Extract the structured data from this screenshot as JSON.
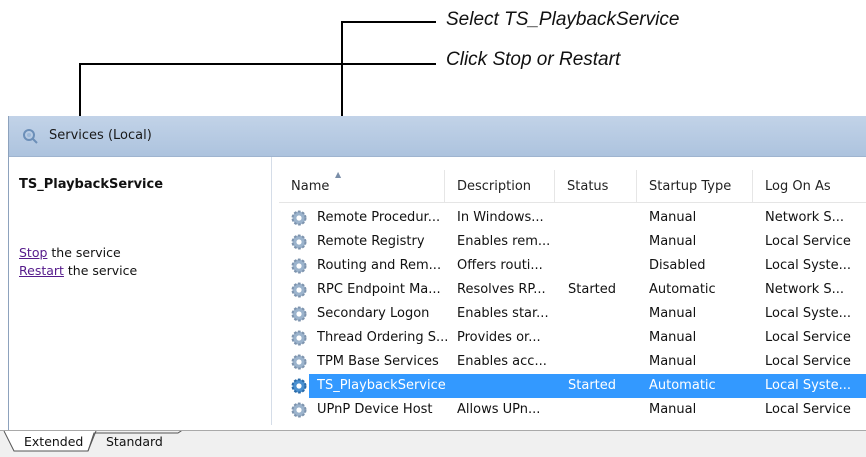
{
  "annotations": {
    "select": "Select TS_PlaybackService",
    "click": "Click Stop or Restart"
  },
  "window": {
    "title": "Services (Local)"
  },
  "left_pane": {
    "service_name": "TS_PlaybackService",
    "stop_link": "Stop",
    "stop_suffix": " the service",
    "restart_link": "Restart",
    "restart_suffix": " the service"
  },
  "table": {
    "columns": [
      "Name",
      "Description",
      "Status",
      "Startup Type",
      "Log On As"
    ],
    "sort_column": "Name",
    "rows": [
      {
        "name": "Remote Procedur...",
        "description": "In Windows...",
        "status": "",
        "startup": "Manual",
        "logon": "Network S..."
      },
      {
        "name": "Remote Registry",
        "description": "Enables rem...",
        "status": "",
        "startup": "Manual",
        "logon": "Local Service"
      },
      {
        "name": "Routing and Rem...",
        "description": "Offers routi...",
        "status": "",
        "startup": "Disabled",
        "logon": "Local Syste..."
      },
      {
        "name": "RPC Endpoint Ma...",
        "description": "Resolves RP...",
        "status": "Started",
        "startup": "Automatic",
        "logon": "Network S..."
      },
      {
        "name": "Secondary Logon",
        "description": "Enables star...",
        "status": "",
        "startup": "Manual",
        "logon": "Local Syste..."
      },
      {
        "name": "Thread Ordering S...",
        "description": "Provides or...",
        "status": "",
        "startup": "Manual",
        "logon": "Local Service"
      },
      {
        "name": "TPM Base Services",
        "description": "Enables acc...",
        "status": "",
        "startup": "Manual",
        "logon": "Local Service"
      },
      {
        "name": "TS_PlaybackService",
        "description": "",
        "status": "Started",
        "startup": "Automatic",
        "logon": "Local Syste..."
      },
      {
        "name": "UPnP Device Host",
        "description": "Allows UPn...",
        "status": "",
        "startup": "Manual",
        "logon": "Local Service"
      }
    ],
    "selected_row": "TS_PlaybackService"
  },
  "tabs": [
    "Extended",
    "Standard"
  ],
  "active_tab": "Extended",
  "colors": {
    "selection": "#3399ff",
    "titlebar": "#b8cbe4",
    "link": "#551a8b"
  },
  "icons": {
    "window": "services-icon",
    "row": "gear-icon"
  }
}
